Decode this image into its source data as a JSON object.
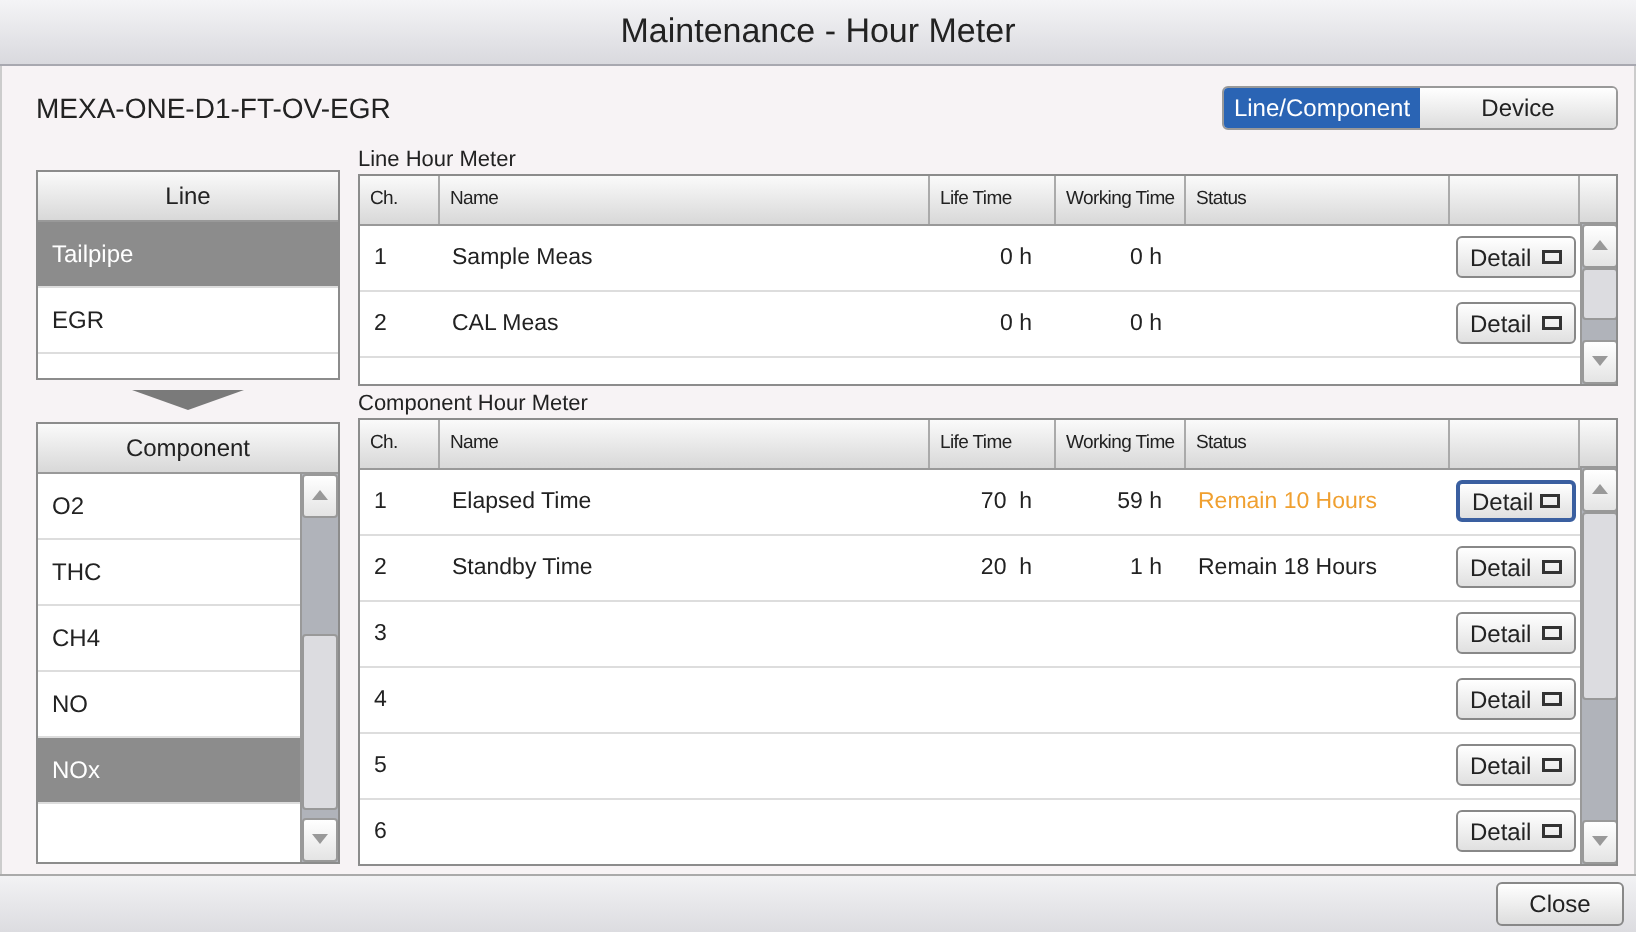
{
  "window": {
    "title": "Maintenance - Hour Meter"
  },
  "device_name": "MEXA-ONE-D1-FT-OV-EGR",
  "view_toggle": [
    {
      "label": "Line/Component",
      "selected": true
    },
    {
      "label": "Device",
      "selected": false
    }
  ],
  "line_list": {
    "header": "Line",
    "items": [
      {
        "label": "Tailpipe",
        "selected": true
      },
      {
        "label": "EGR",
        "selected": false
      }
    ]
  },
  "component_list": {
    "header": "Component",
    "items": [
      {
        "label": "O2",
        "selected": false
      },
      {
        "label": "THC",
        "selected": false
      },
      {
        "label": "CH4",
        "selected": false
      },
      {
        "label": "NO",
        "selected": false
      },
      {
        "label": "NOx",
        "selected": true
      }
    ]
  },
  "line_table": {
    "title": "Line Hour Meter",
    "columns": [
      "Ch.",
      "Name",
      "Life Time",
      "Working Time",
      "Status"
    ],
    "rows": [
      {
        "ch": "1",
        "name": "Sample Meas",
        "life": "0 h",
        "working": "0 h",
        "button": "Detail",
        "focused": false
      },
      {
        "ch": "2",
        "name": "CAL Meas",
        "life": "0 h",
        "working": "0 h",
        "button": "Detail",
        "focused": false
      }
    ]
  },
  "component_table": {
    "title": "Component Hour Meter",
    "columns": [
      "Ch.",
      "Name",
      "Life Time",
      "Working Time",
      "Status"
    ],
    "rows": [
      {
        "ch": "1",
        "name": "Elapsed Time",
        "life": "70  h",
        "working": "59 h",
        "status": "Remain 10 Hours",
        "warning": true,
        "button": "Detail",
        "focused": true
      },
      {
        "ch": "2",
        "name": "Standby Time",
        "life": "20  h",
        "working": "1 h",
        "status": "Remain 18 Hours",
        "warning": false,
        "button": "Detail",
        "focused": false
      },
      {
        "ch": "3",
        "button": "Detail",
        "focused": false
      },
      {
        "ch": "4",
        "button": "Detail",
        "focused": false
      },
      {
        "ch": "5",
        "button": "Detail",
        "focused": false
      },
      {
        "ch": "6",
        "button": "Detail",
        "focused": false
      }
    ]
  },
  "footer": {
    "close_button": "Close"
  }
}
